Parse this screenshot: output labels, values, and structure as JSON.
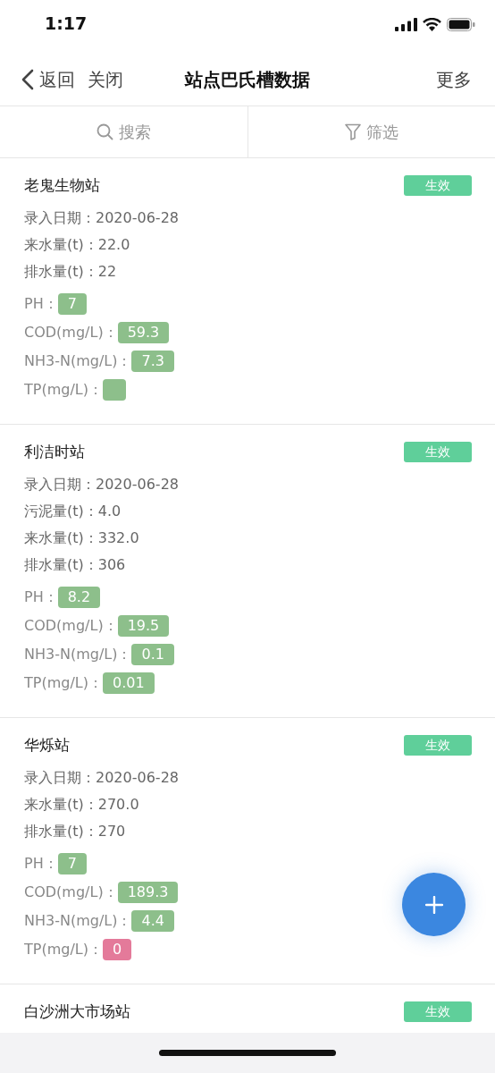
{
  "status_bar": {
    "time": "1:17"
  },
  "nav": {
    "back": "返回",
    "close": "关闭",
    "title": "站点巴氏槽数据",
    "more": "更多"
  },
  "toolbar": {
    "search": "搜索",
    "filter": "筛选"
  },
  "stations": [
    {
      "name": "老鬼生物站",
      "status": "生效",
      "info": [
        "录入日期：2020-06-28",
        "来水量(t)：22.0",
        "排水量(t)：22"
      ],
      "metrics": [
        {
          "label": "PH：",
          "value": "7",
          "color": "#8dbf8b"
        },
        {
          "label": "COD(mg/L)：",
          "value": "59.3",
          "color": "#8dbf8b"
        },
        {
          "label": "NH3-N(mg/L)：",
          "value": "7.3",
          "color": "#8dbf8b"
        },
        {
          "label": "TP(mg/L)：",
          "color": "#8dbf8b"
        }
      ]
    },
    {
      "name": "利洁时站",
      "status": "生效",
      "info": [
        "录入日期：2020-06-28",
        "污泥量(t)：4.0",
        "来水量(t)：332.0",
        "排水量(t)：306"
      ],
      "metrics": [
        {
          "label": "PH：",
          "value": "8.2",
          "color": "#8dbf8b"
        },
        {
          "label": "COD(mg/L)：",
          "value": "19.5",
          "color": "#8dbf8b"
        },
        {
          "label": "NH3-N(mg/L)：",
          "value": "0.1",
          "color": "#8dbf8b"
        },
        {
          "label": "TP(mg/L)：",
          "value": "0.01",
          "color": "#8dbf8b"
        }
      ]
    },
    {
      "name": "华烁站",
      "status": "生效",
      "info": [
        "录入日期：2020-06-28",
        "来水量(t)：270.0",
        "排水量(t)：270"
      ],
      "metrics": [
        {
          "label": "PH：",
          "value": "7",
          "color": "#8dbf8b"
        },
        {
          "label": "COD(mg/L)：",
          "value": "189.3",
          "color": "#8dbf8b"
        },
        {
          "label": "NH3-N(mg/L)：",
          "value": "4.4",
          "color": "#8dbf8b"
        },
        {
          "label": "TP(mg/L)：",
          "value": "0",
          "color": "#e47a9a"
        }
      ]
    },
    {
      "name": "白沙洲大市场站",
      "status": "生效"
    }
  ]
}
